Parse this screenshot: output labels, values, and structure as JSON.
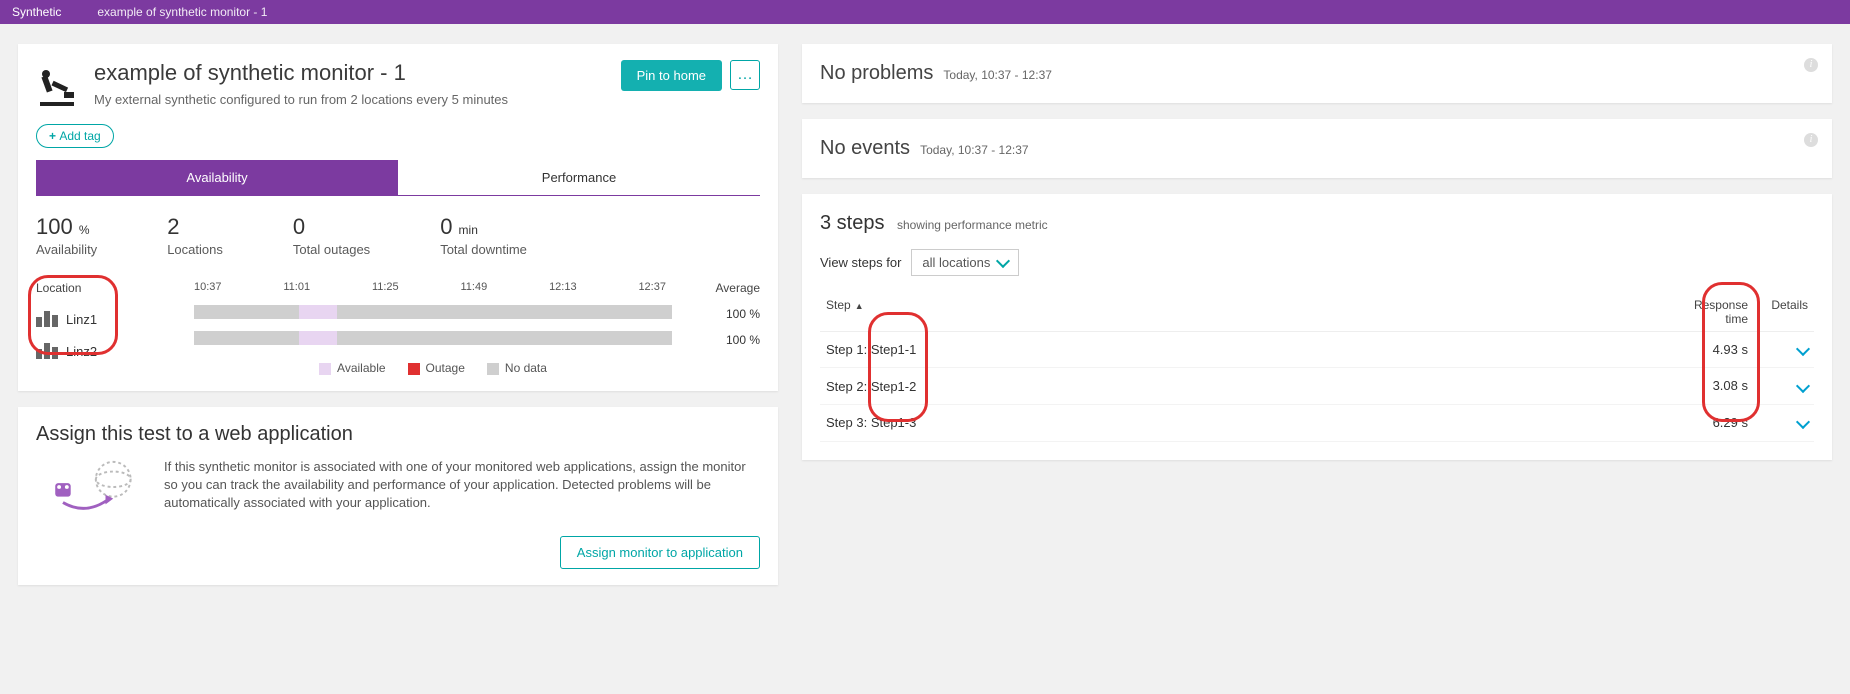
{
  "breadcrumb": {
    "root": "Synthetic",
    "page": "example of synthetic monitor - 1"
  },
  "header": {
    "title": "example of synthetic monitor - 1",
    "subtitle": "My external synthetic configured to run from 2 locations every 5 minutes",
    "pin_label": "Pin to home",
    "more_label": "…",
    "add_tag_label": "Add tag"
  },
  "tabs": {
    "availability": "Availability",
    "performance": "Performance"
  },
  "stats": [
    {
      "value": "100",
      "unit": "%",
      "label": "Availability"
    },
    {
      "value": "2",
      "unit": "",
      "label": "Locations"
    },
    {
      "value": "0",
      "unit": "",
      "label": "Total outages"
    },
    {
      "value": "0",
      "unit": "min",
      "label": "Total downtime"
    }
  ],
  "timeline": {
    "location_header": "Location",
    "average_header": "Average",
    "times": [
      "10:37",
      "11:01",
      "11:25",
      "11:49",
      "12:13",
      "12:37"
    ],
    "locations": [
      {
        "name": "Linz1",
        "average": "100 %"
      },
      {
        "name": "Linz2",
        "average": "100 %"
      }
    ],
    "legend": {
      "available": "Available",
      "outage": "Outage",
      "nodata": "No data"
    },
    "colors": {
      "available": "#e8d5f1",
      "outage": "#e03030",
      "nodata": "#cfcfcf"
    }
  },
  "assign": {
    "title": "Assign this test to a web application",
    "text": "If this synthetic monitor is associated with one of your monitored web applications, assign the monitor so you can track the availability and performance of your application. Detected problems will be automatically associated with your application.",
    "button": "Assign monitor to application"
  },
  "problems": {
    "title": "No problems",
    "range": "Today, 10:37 - 12:37"
  },
  "events": {
    "title": "No events",
    "range": "Today, 10:37 - 12:37"
  },
  "steps": {
    "title": "3 steps",
    "subtitle": "showing performance metric",
    "view_label": "View steps for",
    "dropdown": "all locations",
    "columns": {
      "step": "Step",
      "response": "Response time",
      "details": "Details"
    },
    "rows": [
      {
        "prefix": "Step 1:",
        "name": "Step1-1",
        "time": "4.93 s"
      },
      {
        "prefix": "Step 2:",
        "name": "Step1-2",
        "time": "3.08 s"
      },
      {
        "prefix": "Step 3:",
        "name": "Step1-3",
        "time": "6.29 s"
      }
    ]
  }
}
